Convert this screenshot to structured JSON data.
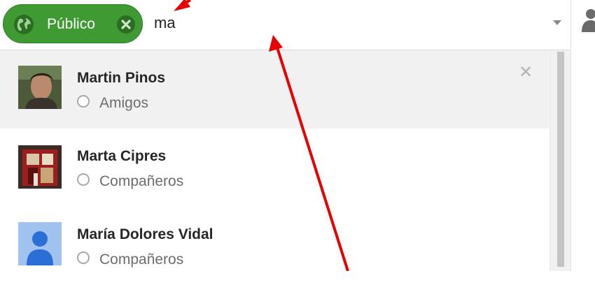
{
  "share_box": {
    "chip": {
      "label": "Público",
      "color": "#3f9a33",
      "icon": "globe-icon"
    },
    "query": "ma"
  },
  "suggestions": [
    {
      "name": "Martin Pinos",
      "circle": "Amigos",
      "selected": true
    },
    {
      "name": "Marta Cipres",
      "circle": "Compañeros",
      "selected": false
    },
    {
      "name": "María Dolores Vidal",
      "circle": "Compañeros",
      "selected": false
    }
  ],
  "annotation_color": "#e60000"
}
